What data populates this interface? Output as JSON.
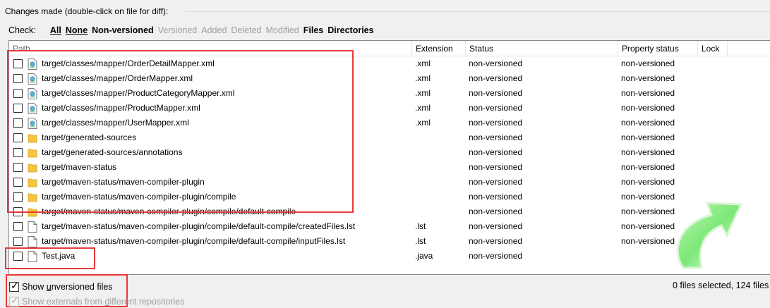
{
  "group_title": "Changes made (double-click on file for diff):",
  "check": {
    "label": "Check:",
    "options": [
      {
        "text": "All",
        "enabled": true
      },
      {
        "text": "None",
        "enabled": true
      },
      {
        "text": "Non-versioned",
        "enabled": true
      },
      {
        "text": "Versioned",
        "enabled": false
      },
      {
        "text": "Added",
        "enabled": false
      },
      {
        "text": "Deleted",
        "enabled": false
      },
      {
        "text": "Modified",
        "enabled": false
      },
      {
        "text": "Files",
        "enabled": true
      },
      {
        "text": "Directories",
        "enabled": true
      }
    ]
  },
  "columns": {
    "path": "Path",
    "extension": "Extension",
    "status": "Status",
    "property_status": "Property status",
    "lock": "Lock"
  },
  "rows": [
    {
      "path": "target/classes/mapper/OrderDetailMapper.xml",
      "extension": ".xml",
      "status": "non-versioned",
      "property_status": "non-versioned",
      "icon": "xml-file-icon"
    },
    {
      "path": "target/classes/mapper/OrderMapper.xml",
      "extension": ".xml",
      "status": "non-versioned",
      "property_status": "non-versioned",
      "icon": "xml-file-icon"
    },
    {
      "path": "target/classes/mapper/ProductCategoryMapper.xml",
      "extension": ".xml",
      "status": "non-versioned",
      "property_status": "non-versioned",
      "icon": "xml-file-icon"
    },
    {
      "path": "target/classes/mapper/ProductMapper.xml",
      "extension": ".xml",
      "status": "non-versioned",
      "property_status": "non-versioned",
      "icon": "xml-file-icon"
    },
    {
      "path": "target/classes/mapper/UserMapper.xml",
      "extension": ".xml",
      "status": "non-versioned",
      "property_status": "non-versioned",
      "icon": "xml-file-icon"
    },
    {
      "path": "target/generated-sources",
      "extension": "",
      "status": "non-versioned",
      "property_status": "non-versioned",
      "icon": "folder-icon"
    },
    {
      "path": "target/generated-sources/annotations",
      "extension": "",
      "status": "non-versioned",
      "property_status": "non-versioned",
      "icon": "folder-icon"
    },
    {
      "path": "target/maven-status",
      "extension": "",
      "status": "non-versioned",
      "property_status": "non-versioned",
      "icon": "folder-icon"
    },
    {
      "path": "target/maven-status/maven-compiler-plugin",
      "extension": "",
      "status": "non-versioned",
      "property_status": "non-versioned",
      "icon": "folder-icon"
    },
    {
      "path": "target/maven-status/maven-compiler-plugin/compile",
      "extension": "",
      "status": "non-versioned",
      "property_status": "non-versioned",
      "icon": "folder-icon"
    },
    {
      "path": "target/maven-status/maven-compiler-plugin/compile/default-compile",
      "extension": "",
      "status": "non-versioned",
      "property_status": "non-versioned",
      "icon": "folder-icon"
    },
    {
      "path": "target/maven-status/maven-compiler-plugin/compile/default-compile/createdFiles.lst",
      "extension": ".lst",
      "status": "non-versioned",
      "property_status": "non-versioned",
      "icon": "file-icon"
    },
    {
      "path": "target/maven-status/maven-compiler-plugin/compile/default-compile/inputFiles.lst",
      "extension": ".lst",
      "status": "non-versioned",
      "property_status": "non-versioned",
      "icon": "file-icon"
    },
    {
      "path": "Test.java",
      "extension": ".java",
      "status": "non-versioned",
      "property_status": "",
      "icon": "file-icon"
    }
  ],
  "show_unversioned": {
    "pre": "Show ",
    "accel": "u",
    "post": "nversioned files",
    "checked": true
  },
  "show_externals": {
    "pre": "Show externals from ",
    "accel": "d",
    "post": "ifferent repositories",
    "checked": true,
    "enabled": false
  },
  "summary": "0 files selected, 124 files",
  "colors": {
    "highlight": "#e8393a",
    "folder": "#f5c542",
    "arrow": "#5ee05a"
  }
}
